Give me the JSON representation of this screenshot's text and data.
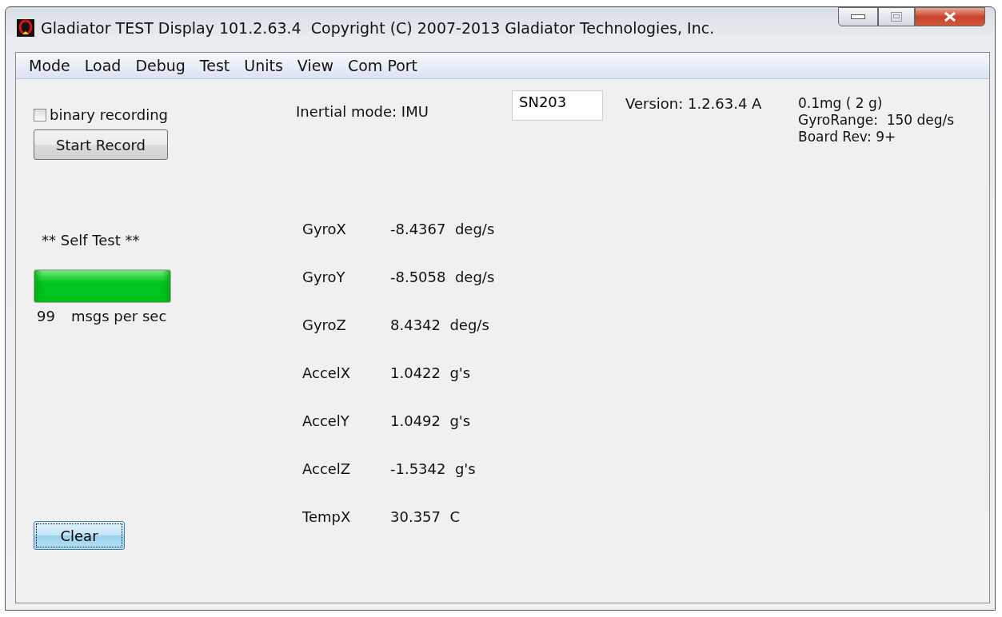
{
  "window": {
    "title": "Gladiator TEST Display 101.2.63.4  Copyright (C) 2007-2013 Gladiator Technologies, Inc."
  },
  "menu": [
    "Mode",
    "Load",
    "Debug",
    "Test",
    "Units",
    "View",
    "Com Port"
  ],
  "recording": {
    "checkbox": {
      "label": "binary recording",
      "checked": false
    },
    "button": "Start Record"
  },
  "self_test": {
    "label": "** Self Test **",
    "level": 1,
    "rate": "99",
    "rate_unit": "msgs per sec"
  },
  "clear_button": "Clear",
  "header": {
    "inertial_mode": "Inertial mode: IMU",
    "serial": "SN203",
    "version": "Version: 1.2.63.4 A",
    "info": [
      "0.1mg ( 2 g)",
      "GyroRange:  150 deg/s",
      "Board Rev: 9+"
    ]
  },
  "readings": [
    {
      "name": "GyroX",
      "value": "-8.4367  deg/s"
    },
    {
      "name": "GyroY",
      "value": "-8.5058  deg/s"
    },
    {
      "name": "GyroZ",
      "value": "8.4342  deg/s"
    },
    {
      "name": "AccelX",
      "value": "1.0422  g's"
    },
    {
      "name": "AccelY",
      "value": "1.0492  g's"
    },
    {
      "name": "AccelZ",
      "value": "-1.5342  g's"
    },
    {
      "name": "TempX",
      "value": "30.357  C"
    }
  ]
}
